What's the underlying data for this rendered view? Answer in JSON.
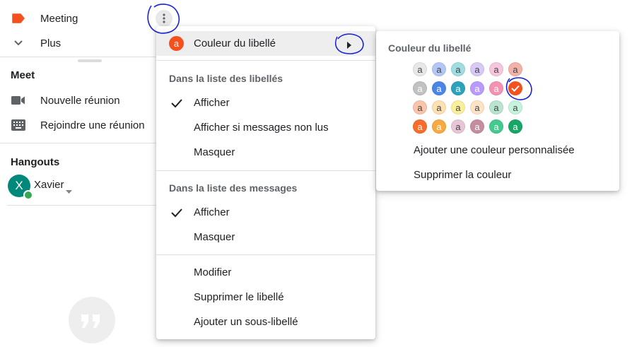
{
  "sidebar": {
    "labels": [
      {
        "label": "Meeting",
        "icon": "label-icon",
        "color": "#f4511e"
      },
      {
        "label": "Plus",
        "icon": "chevron-down-icon"
      }
    ],
    "meet": {
      "title": "Meet",
      "items": [
        {
          "label": "Nouvelle réunion",
          "icon": "video-camera-icon"
        },
        {
          "label": "Rejoindre une réunion",
          "icon": "keyboard-icon"
        }
      ]
    },
    "hangouts": {
      "title": "Hangouts",
      "user": {
        "name": "Xavier",
        "initial": "X",
        "avatar_color": "#00897b",
        "status_color": "#34a853"
      }
    }
  },
  "context_menu": {
    "color_item": {
      "label": "Couleur du libellé",
      "badge": "a",
      "badge_color": "#f4511e"
    },
    "label_list": {
      "header": "Dans la liste des libellés",
      "options": [
        {
          "label": "Afficher",
          "checked": true
        },
        {
          "label": "Afficher si messages non lus",
          "checked": false
        },
        {
          "label": "Masquer",
          "checked": false
        }
      ]
    },
    "message_list": {
      "header": "Dans la liste des messages",
      "options": [
        {
          "label": "Afficher",
          "checked": true
        },
        {
          "label": "Masquer",
          "checked": false
        }
      ]
    },
    "actions": [
      "Modifier",
      "Supprimer le libellé",
      "Ajouter un sous-libellé"
    ]
  },
  "color_submenu": {
    "title": "Couleur du libellé",
    "swatch_letter": "a",
    "palette": [
      [
        {
          "bg": "#e8e8e8",
          "fg": "#444"
        },
        {
          "bg": "#b3c7f7",
          "fg": "#444"
        },
        {
          "bg": "#9fdde3",
          "fg": "#444"
        },
        {
          "bg": "#d9c9f7",
          "fg": "#444"
        },
        {
          "bg": "#f7c6dd",
          "fg": "#444"
        },
        {
          "bg": "#f2b2a8",
          "fg": "#444"
        }
      ],
      [
        {
          "bg": "#c2c2c2",
          "fg": "#fff"
        },
        {
          "bg": "#4a86e8",
          "fg": "#fff"
        },
        {
          "bg": "#2da2bb",
          "fg": "#fff"
        },
        {
          "bg": "#b99aff",
          "fg": "#fff"
        },
        {
          "bg": "#f691b2",
          "fg": "#fff"
        },
        {
          "bg": "#f4511e",
          "fg": "#fff",
          "selected": true
        }
      ],
      [
        {
          "bg": "#f9c4a9",
          "fg": "#444"
        },
        {
          "bg": "#fde1b1",
          "fg": "#444"
        },
        {
          "bg": "#fcef9b",
          "fg": "#444"
        },
        {
          "bg": "#fde4c6",
          "fg": "#444"
        },
        {
          "bg": "#b9e4d0",
          "fg": "#444"
        },
        {
          "bg": "#c6f3de",
          "fg": "#444"
        }
      ],
      [
        {
          "bg": "#f96c2a",
          "fg": "#fff"
        },
        {
          "bg": "#f8a940",
          "fg": "#fff"
        },
        {
          "bg": "#e7c6d7",
          "fg": "#444"
        },
        {
          "bg": "#c48e9f",
          "fg": "#fff"
        },
        {
          "bg": "#44c98f",
          "fg": "#fff"
        },
        {
          "bg": "#16a766",
          "fg": "#fff"
        }
      ]
    ],
    "actions": [
      "Ajouter une couleur personnalisée",
      "Supprimer la couleur"
    ]
  },
  "annotation_color": "#1a22d6"
}
